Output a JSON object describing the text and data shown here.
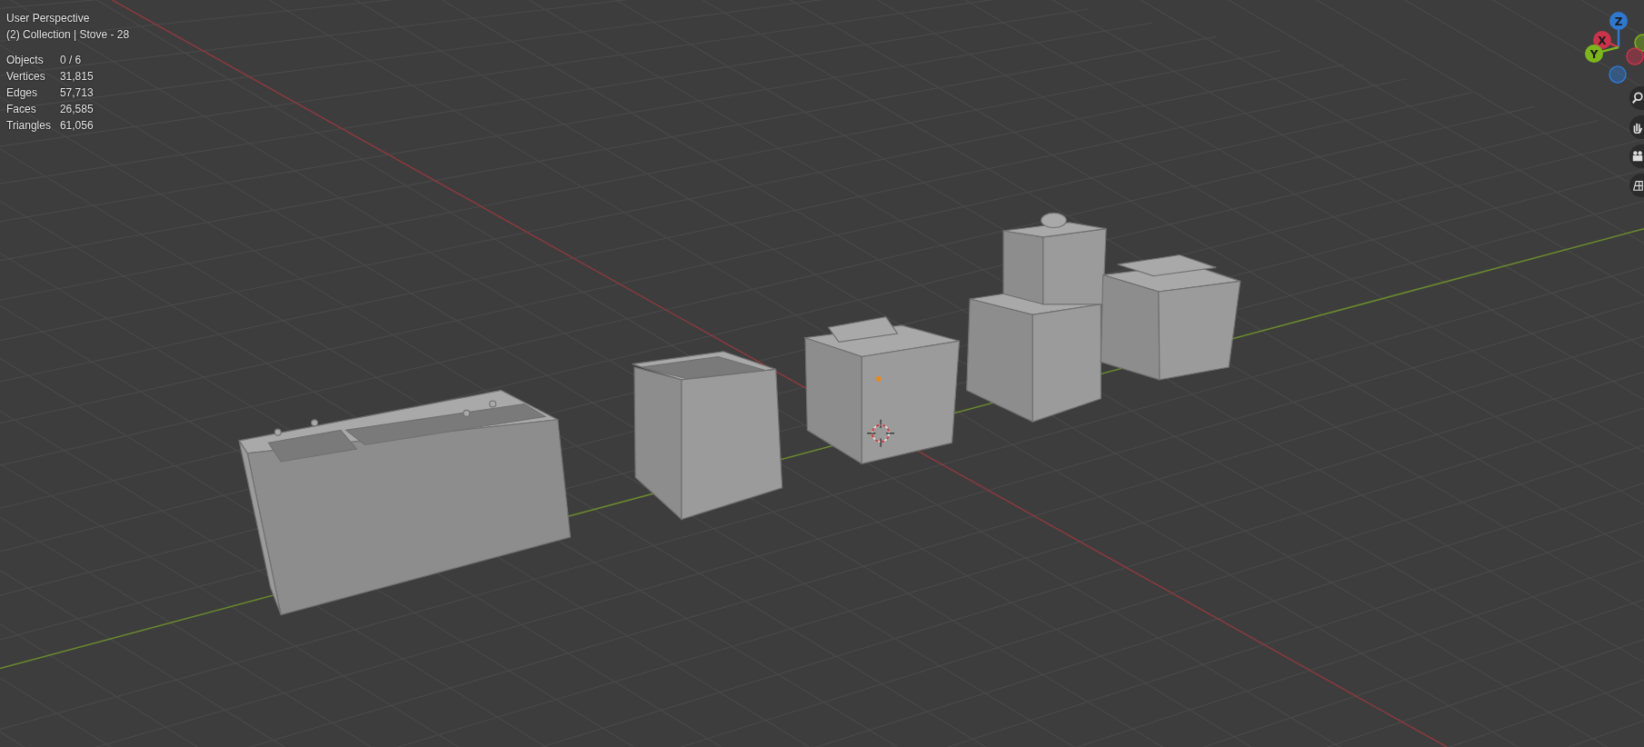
{
  "viewport": {
    "view_name": "User Perspective",
    "context": "(2) Collection | Stove - 28",
    "statistics": [
      {
        "label": "Objects",
        "value": "0 / 6"
      },
      {
        "label": "Vertices",
        "value": "31,815"
      },
      {
        "label": "Edges",
        "value": "57,713"
      },
      {
        "label": "Faces",
        "value": "26,585"
      },
      {
        "label": "Triangles",
        "value": "61,056"
      }
    ]
  },
  "navigation_gizmo": {
    "axes": [
      {
        "kind": "positive",
        "label": "Z",
        "color": "#2f78d0"
      },
      {
        "kind": "positive",
        "label": "X",
        "color": "#c9344b"
      },
      {
        "kind": "positive",
        "label": "Y",
        "color": "#7cb51c"
      },
      {
        "kind": "negative",
        "color": "#7cb51c"
      },
      {
        "kind": "negative",
        "color": "#c9344b"
      },
      {
        "kind": "negative",
        "color": "#2f78d0"
      }
    ]
  }
}
